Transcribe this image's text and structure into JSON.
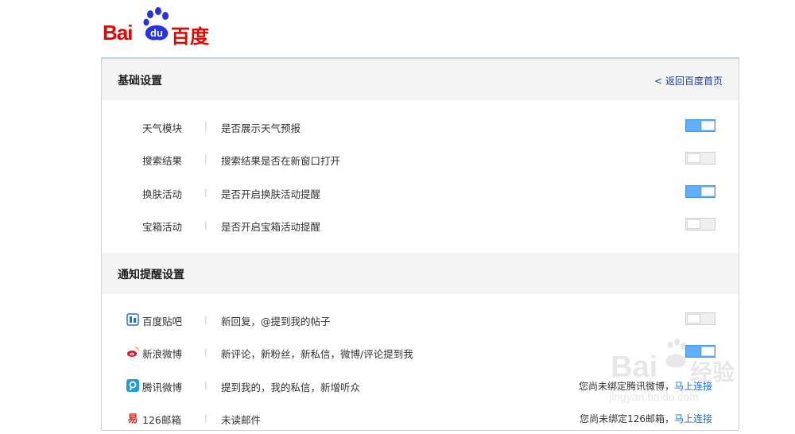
{
  "logo": {
    "latin_a": "Bai",
    "latin_b": "du",
    "cn": "百度"
  },
  "section1": {
    "title": "基础设置",
    "back_link": "< 返回百度首页",
    "rows": [
      {
        "name": "天气模块",
        "desc": "是否展示天气预报",
        "enabled": true
      },
      {
        "name": "搜索结果",
        "desc": "搜索结果是否在新窗口打开",
        "enabled": false
      },
      {
        "name": "换肤活动",
        "desc": "是否开启换肤活动提醒",
        "enabled": true
      },
      {
        "name": "宝箱活动",
        "desc": "是否开启宝箱活动提醒",
        "enabled": false
      }
    ]
  },
  "section2": {
    "title": "通知提醒设置",
    "rows": [
      {
        "icon": "tieba-icon",
        "name": "百度贴吧",
        "desc": "新回复，@提到我的帖子",
        "enabled": false
      },
      {
        "icon": "weibo-icon",
        "name": "新浪微博",
        "desc": "新评论，新粉丝，新私信，微博/评论提到我",
        "enabled": true
      },
      {
        "icon": "tencent-weibo-icon",
        "name": "腾讯微博",
        "desc": "提到我的，我的私信，新增听众",
        "bind_note": "您尚未绑定腾讯微博，",
        "bind_link": "马上连接"
      },
      {
        "icon": "mail-126-icon",
        "name": "126邮箱",
        "desc": "未读邮件",
        "bind_note": "您尚未绑定126邮箱，",
        "bind_link": "马上连接"
      }
    ]
  },
  "separator": "|",
  "watermark": {
    "brand": "Bai",
    "cn": "经验",
    "url": "jingyan.baidu.com"
  },
  "colors": {
    "brand_red": "#e10601",
    "toggle_on": "#5aa9f2",
    "link_blue": "#1b6fd0"
  }
}
